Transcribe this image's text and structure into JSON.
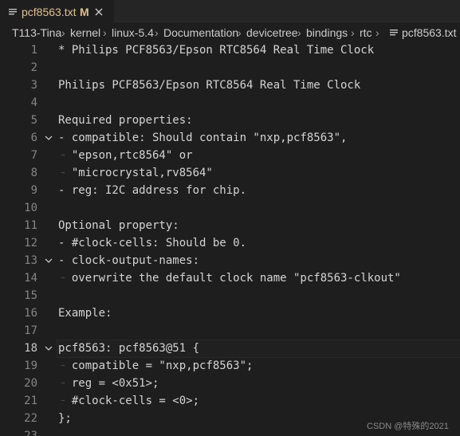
{
  "tab": {
    "title": "pcf8563.txt",
    "modified": "M",
    "accent": "#e2c08d"
  },
  "breadcrumb": [
    "T113-Tina",
    "kernel",
    "linux-5.4",
    "Documentation",
    "devicetree",
    "bindings",
    "rtc",
    "pcf8563.txt"
  ],
  "editor": {
    "lines": [
      "* Philips PCF8563/Epson RTC8564 Real Time Clock",
      "",
      "Philips PCF8563/Epson RTC8564 Real Time Clock",
      "",
      "Required properties:",
      "- compatible: Should contain \"nxp,pcf8563\",",
      "  \"epson,rtc8564\" or",
      "  \"microcrystal,rv8564\"",
      "- reg: I2C address for chip.",
      "",
      "Optional property:",
      "- #clock-cells: Should be 0.",
      "- clock-output-names:",
      "  overwrite the default clock name \"pcf8563-clkout\"",
      "",
      "Example:",
      "",
      "pcf8563: pcf8563@51 {",
      "  compatible = \"nxp,pcf8563\";",
      "  reg = <0x51>;",
      "  #clock-cells = <0>;",
      "};",
      ""
    ],
    "line_numbers": [
      "1",
      "2",
      "3",
      "4",
      "5",
      "6",
      "7",
      "8",
      "9",
      "10",
      "11",
      "12",
      "13",
      "14",
      "15",
      "16",
      "17",
      "18",
      "19",
      "20",
      "21",
      "22",
      "23"
    ],
    "current_line": "18"
  },
  "watermark": "CSDN @特殊的2021"
}
